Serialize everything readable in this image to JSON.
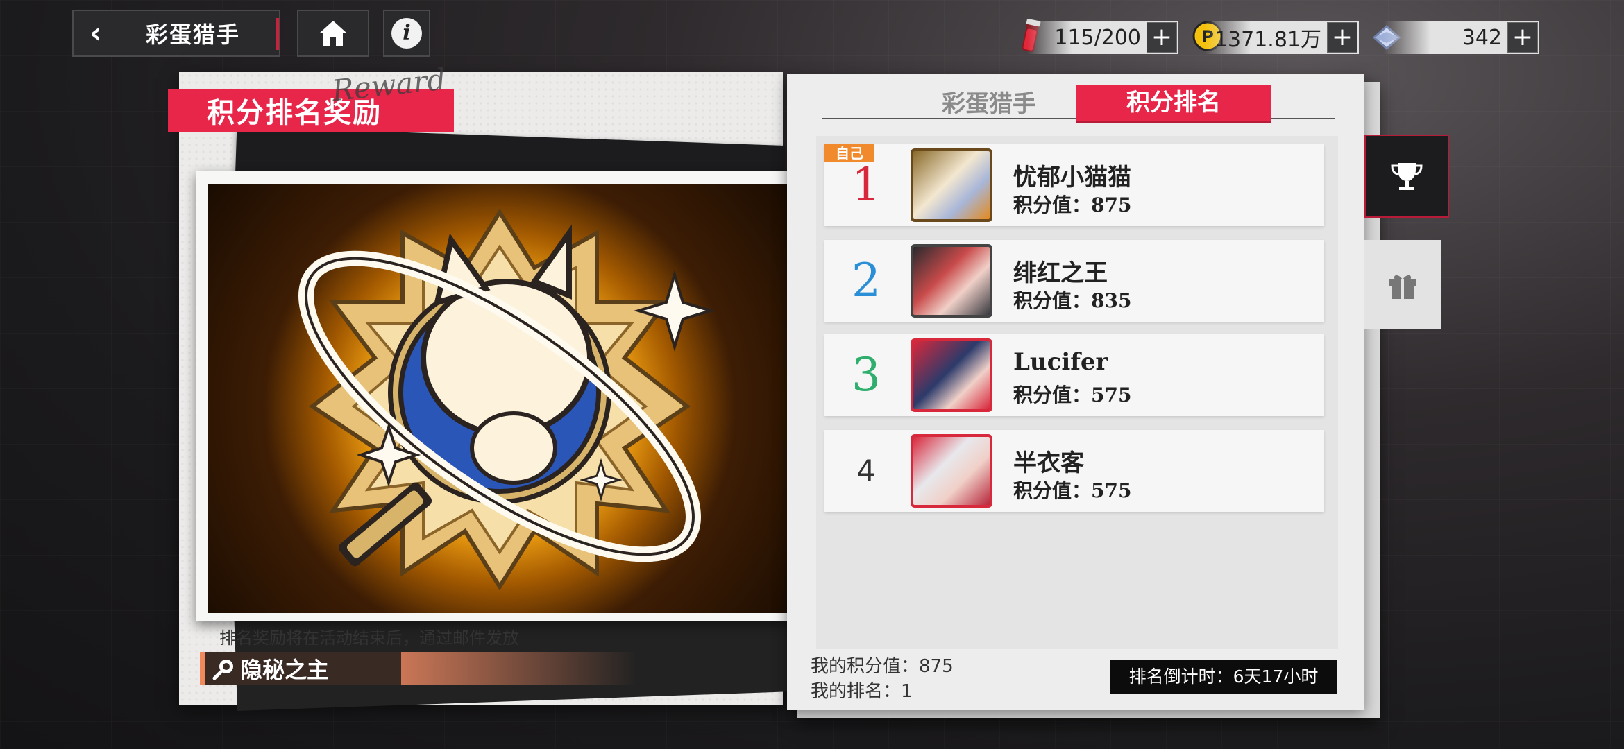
{
  "nav": {
    "title": "彩蛋猎手"
  },
  "currencies": [
    {
      "name": "stamina",
      "value": "115/200",
      "icon": "red-vial-icon",
      "color": "#c8213c"
    },
    {
      "name": "coins",
      "value": "1371.81万",
      "icon": "coin-icon",
      "color": "#f4c20d"
    },
    {
      "name": "gems",
      "value": "342",
      "icon": "crystal-icon",
      "color": "#8fa6d8"
    }
  ],
  "left": {
    "banner": "积分排名奖励",
    "banner_script": "Reward",
    "note": "排名奖励将在活动结束后，通过邮件发放",
    "reward_name": "隐秘之主"
  },
  "tabs": [
    {
      "label": "彩蛋猎手",
      "active": false
    },
    {
      "label": "积分排名",
      "active": true
    }
  ],
  "ranking": {
    "self_label": "自己",
    "rows": [
      {
        "rank": "1",
        "name": "忧郁小猫猫",
        "score": "积分值：875",
        "rank_color": "#d8283c",
        "is_self": true
      },
      {
        "rank": "2",
        "name": "绯红之王",
        "score": "积分值：835",
        "rank_color": "#2a8fd6",
        "is_self": false
      },
      {
        "rank": "3",
        "name": "Lucifer",
        "score": "积分值：575",
        "rank_color": "#2fae6e",
        "is_self": false
      },
      {
        "rank": "4",
        "name": "半衣客",
        "score": "积分值：575",
        "rank_color": "#333333",
        "is_self": false
      }
    ],
    "my_score": "我的积分值：875",
    "my_rank": "我的排名：1",
    "countdown": "排名倒计时：6天17小时"
  },
  "side_tabs": [
    {
      "icon": "trophy-icon",
      "active": true
    },
    {
      "icon": "gift-icon",
      "active": false
    }
  ]
}
